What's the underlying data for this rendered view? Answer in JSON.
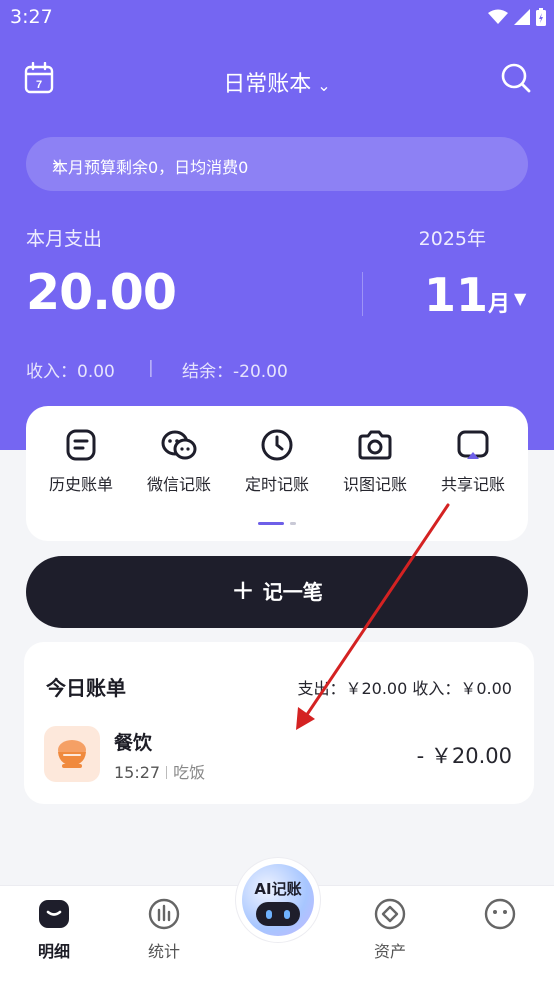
{
  "status_bar": {
    "time": "3:27"
  },
  "header": {
    "title": "日常账本"
  },
  "budget_banner": {
    "text": "本月预算剩余0，日均消费0"
  },
  "summary": {
    "expense_label": "本月支出",
    "expense_amount": "20.00",
    "year": "2025年",
    "month_number": "11",
    "month_unit": "月",
    "income": "收入：0.00",
    "balance": "结余：-20.00"
  },
  "tools": [
    {
      "label": "历史账单",
      "icon": "bill-list-icon"
    },
    {
      "label": "微信记账",
      "icon": "wechat-icon"
    },
    {
      "label": "定时记账",
      "icon": "clock-icon"
    },
    {
      "label": "识图记账",
      "icon": "camera-icon"
    },
    {
      "label": "共享记账",
      "icon": "share-screen-icon"
    }
  ],
  "record_button": {
    "label": "记一笔"
  },
  "today": {
    "title": "今日账单",
    "summary": "支出：￥20.00   收入：￥0.00",
    "entries": [
      {
        "category": "餐饮",
        "time": "15:27",
        "note": "吃饭",
        "amount": "- ￥20.00",
        "icon": "rice-bowl-icon"
      }
    ]
  },
  "tabbar": {
    "items": [
      {
        "label": "明细",
        "icon": "detail-icon",
        "active": true
      },
      {
        "label": "统计",
        "icon": "chart-icon",
        "active": false
      },
      {
        "label": "资产",
        "icon": "diamond-icon",
        "active": false
      },
      {
        "label": "",
        "icon": "face-icon",
        "active": false
      }
    ],
    "ai_label": "AI记账"
  },
  "colors": {
    "accent": "#7566f2",
    "dark_button": "#1e1e2b",
    "annotation_arrow": "#d42222"
  }
}
